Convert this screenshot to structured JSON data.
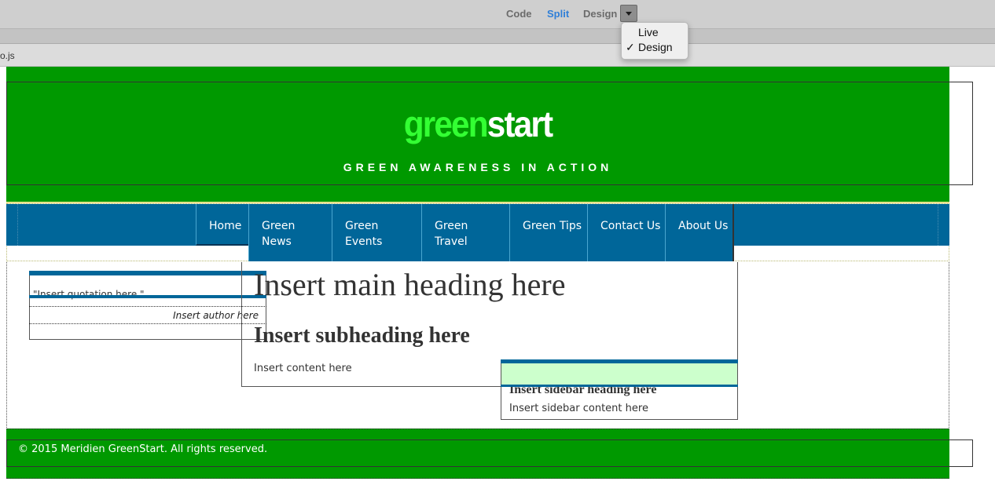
{
  "toolbar": {
    "views": [
      {
        "label": "Code",
        "active": false
      },
      {
        "label": "Split",
        "active": true
      },
      {
        "label": "Design",
        "active": false
      }
    ]
  },
  "dropdown": {
    "items": [
      {
        "label": "Live",
        "checked": false
      },
      {
        "label": "Design",
        "checked": true
      }
    ],
    "check_mark": "✓"
  },
  "file_tab": "o.js",
  "site": {
    "logo_green": "green",
    "logo_white": "start",
    "tagline": "GREEN AWARENESS IN ACTION",
    "nav": [
      {
        "label": "Home"
      },
      {
        "label": "Green News"
      },
      {
        "label": "Green Events"
      },
      {
        "label": "Green Travel"
      },
      {
        "label": "Green Tips"
      },
      {
        "label": "Contact Us"
      },
      {
        "label": "About Us"
      }
    ],
    "quote": "\"Insert quotation here.\"",
    "author": "Insert author here",
    "main_heading": "Insert main heading here",
    "sub_heading": "Insert subheading here",
    "main_content": "Insert content here",
    "sidebar_heading": "Insert sidebar heading here",
    "sidebar_content": "Insert sidebar content here",
    "footer": "© 2015 Meridien GreenStart. All rights reserved."
  },
  "colors": {
    "header_green": "#009900",
    "nav_blue": "#006699",
    "sidebar_mint": "#ccffcc",
    "active_view": "#2f7fd8"
  }
}
